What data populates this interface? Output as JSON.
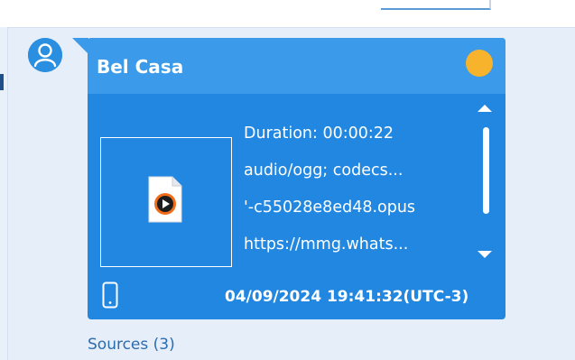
{
  "message": {
    "sender": "Bel Casa",
    "status_color": "#f7b32b",
    "attachment_icon": "audio-file-icon",
    "details": [
      "Duration: 00:00:22",
      "audio/ogg; codecs...",
      "'-c55028e8ed48.opus",
      "https://mmg.whats..."
    ],
    "source_icon": "phone-icon",
    "timestamp": "04/09/2024 19:41:32(UTC-3)"
  },
  "sources_link": "Sources (3)",
  "colors": {
    "card": "#2187e0",
    "header": "#3b9bea",
    "background": "#e6eef9",
    "link": "#2b6cb0"
  }
}
